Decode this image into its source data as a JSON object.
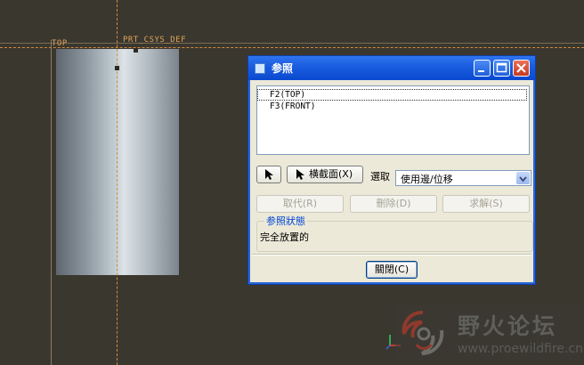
{
  "viewport": {
    "datum_top_label": "TOP",
    "datum_csys_label": "PRT_CSYS_DEF"
  },
  "watermark": {
    "title": "野火论坛",
    "url": "www.proewildfire.cn"
  },
  "dialog": {
    "title": "参照",
    "references": [
      "F2(TOP)",
      "F3(FRONT)"
    ],
    "cross_section_button": "横截面(X)",
    "select_label": "選取",
    "select_value": "使用邊/位移",
    "replace_button": "取代(R)",
    "delete_button": "刪除(D)",
    "solve_button": "求解(S)",
    "status_group_title": "参照狀態",
    "status_text": "完全放置的",
    "close_button": "關閉(C)"
  },
  "colors": {
    "datum": "#d48a3c",
    "titlebar": "#0a49cf",
    "group_title": "#0046d5"
  }
}
